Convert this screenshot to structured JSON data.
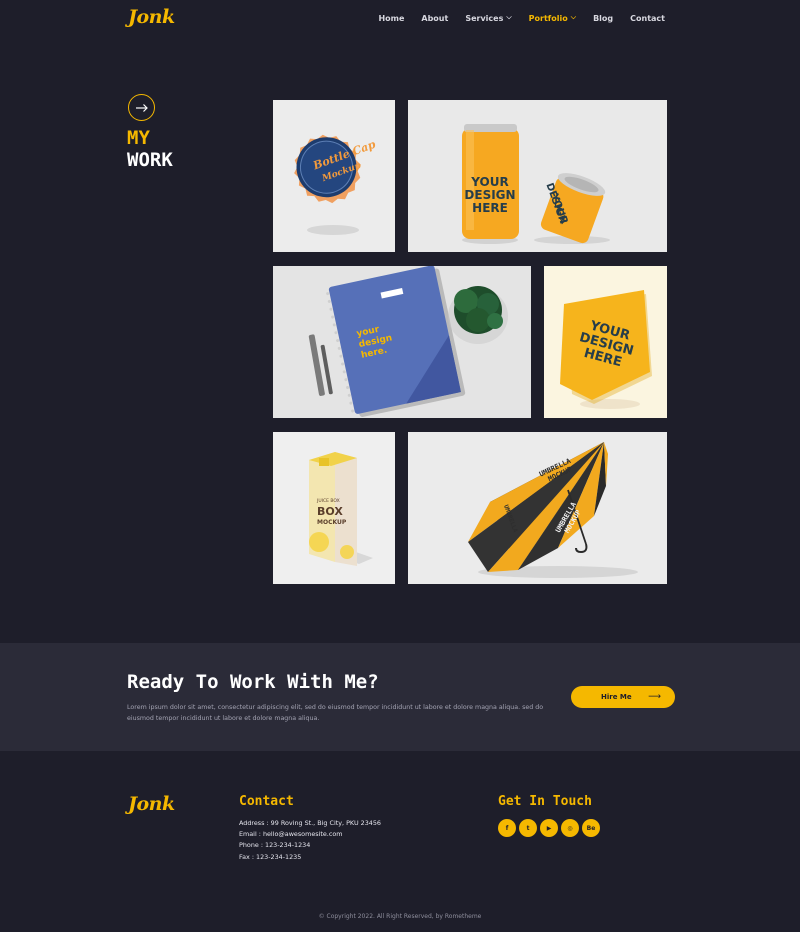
{
  "brand": {
    "logo_text": "Jonk"
  },
  "nav": {
    "items": [
      {
        "label": "Home",
        "dropdown": false,
        "active": false
      },
      {
        "label": "About",
        "dropdown": false,
        "active": false
      },
      {
        "label": "Services",
        "dropdown": true,
        "active": false
      },
      {
        "label": "Portfolio",
        "dropdown": true,
        "active": true
      },
      {
        "label": "Blog",
        "dropdown": false,
        "active": false
      },
      {
        "label": "Contact",
        "dropdown": false,
        "active": false
      }
    ]
  },
  "hero": {
    "title_line1": "MY",
    "title_line2": "WORK",
    "icon": "arrow-right-icon"
  },
  "gallery": {
    "items": [
      {
        "name": "bottle-cap-mockup",
        "text_lines": [
          "Bottle Cap",
          "Mockup"
        ]
      },
      {
        "name": "soda-can-mockup",
        "text_lines": [
          "YOUR",
          "DESIGN",
          "HERE"
        ]
      },
      {
        "name": "notebook-mockup",
        "text_lines": [
          "your",
          "design",
          "here."
        ]
      },
      {
        "name": "paper-poster-mockup",
        "text_lines": [
          "YOUR",
          "DESIGN",
          "HERE"
        ]
      },
      {
        "name": "juice-box-mockup",
        "text_lines": [
          "JUICE BOX",
          "BOX",
          "MOCKUP"
        ]
      },
      {
        "name": "umbrella-mockup",
        "text_lines": [
          "UMBRELLA",
          "MOCKUP"
        ]
      }
    ]
  },
  "cta": {
    "title": "Ready To Work With Me?",
    "text": "Lorem ipsum dolor sit amet, consectetur adipiscing elit, sed do eiusmod tempor incididunt ut labore et dolore magna aliqua. sed do eiusmod tempor incididunt ut labore et dolore magna aliqua.",
    "button_label": "Hire Me",
    "button_icon": "arrow-right-icon"
  },
  "footer": {
    "logo_text": "Jonk",
    "contact_heading": "Contact",
    "contact_lines": [
      "Address : 99 Roving St., Big City, PKU 23456",
      "Email : hello@awesomesite.com",
      "Phone : 123-234-1234",
      "Fax : 123-234-1235"
    ],
    "touch_heading": "Get In Touch",
    "socials": [
      {
        "name": "facebook-icon",
        "glyph": "f"
      },
      {
        "name": "twitter-icon",
        "glyph": "t"
      },
      {
        "name": "youtube-icon",
        "glyph": "▶"
      },
      {
        "name": "dribbble-icon",
        "glyph": "◎"
      },
      {
        "name": "behance-icon",
        "glyph": "Be"
      }
    ],
    "copyright": "© Copyright 2022. All Right Reserved, by Rometheme"
  },
  "colors": {
    "background": "#1e1e2a",
    "band": "#2b2b38",
    "accent": "#f5b800",
    "muted_text": "#a3a3b2"
  }
}
